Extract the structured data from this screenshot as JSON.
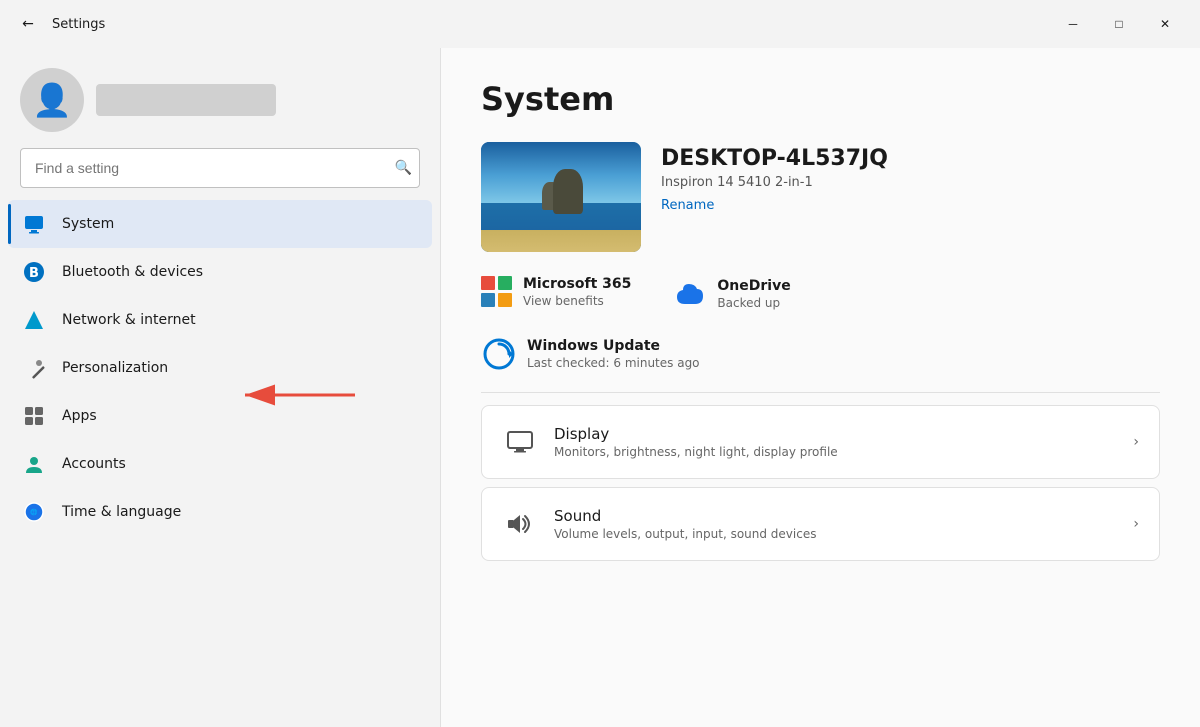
{
  "window": {
    "title": "Settings",
    "controls": {
      "minimize": "─",
      "maximize": "□",
      "close": "✕"
    }
  },
  "sidebar": {
    "search_placeholder": "Find a setting",
    "nav_items": [
      {
        "id": "system",
        "label": "System",
        "icon": "🖥️",
        "active": true
      },
      {
        "id": "bluetooth",
        "label": "Bluetooth & devices",
        "icon": "🔵",
        "active": false
      },
      {
        "id": "network",
        "label": "Network & internet",
        "icon": "💎",
        "active": false
      },
      {
        "id": "personalization",
        "label": "Personalization",
        "icon": "✏️",
        "active": false
      },
      {
        "id": "apps",
        "label": "Apps",
        "icon": "📦",
        "active": false
      },
      {
        "id": "accounts",
        "label": "Accounts",
        "icon": "👤",
        "active": false
      },
      {
        "id": "time",
        "label": "Time & language",
        "icon": "🌐",
        "active": false
      }
    ]
  },
  "main": {
    "page_title": "System",
    "device": {
      "name": "DESKTOP-4L537JQ",
      "model": "Inspiron 14 5410 2-in-1",
      "rename_label": "Rename"
    },
    "quick_info": [
      {
        "id": "ms365",
        "title": "Microsoft 365",
        "sub": "View benefits"
      },
      {
        "id": "onedrive",
        "title": "OneDrive",
        "sub": "Backed up"
      }
    ],
    "windows_update": {
      "title": "Windows Update",
      "sub": "Last checked: 6 minutes ago"
    },
    "settings_cards": [
      {
        "id": "display",
        "title": "Display",
        "sub": "Monitors, brightness, night light, display profile"
      },
      {
        "id": "sound",
        "title": "Sound",
        "sub": "Volume levels, output, input, sound devices"
      }
    ]
  }
}
